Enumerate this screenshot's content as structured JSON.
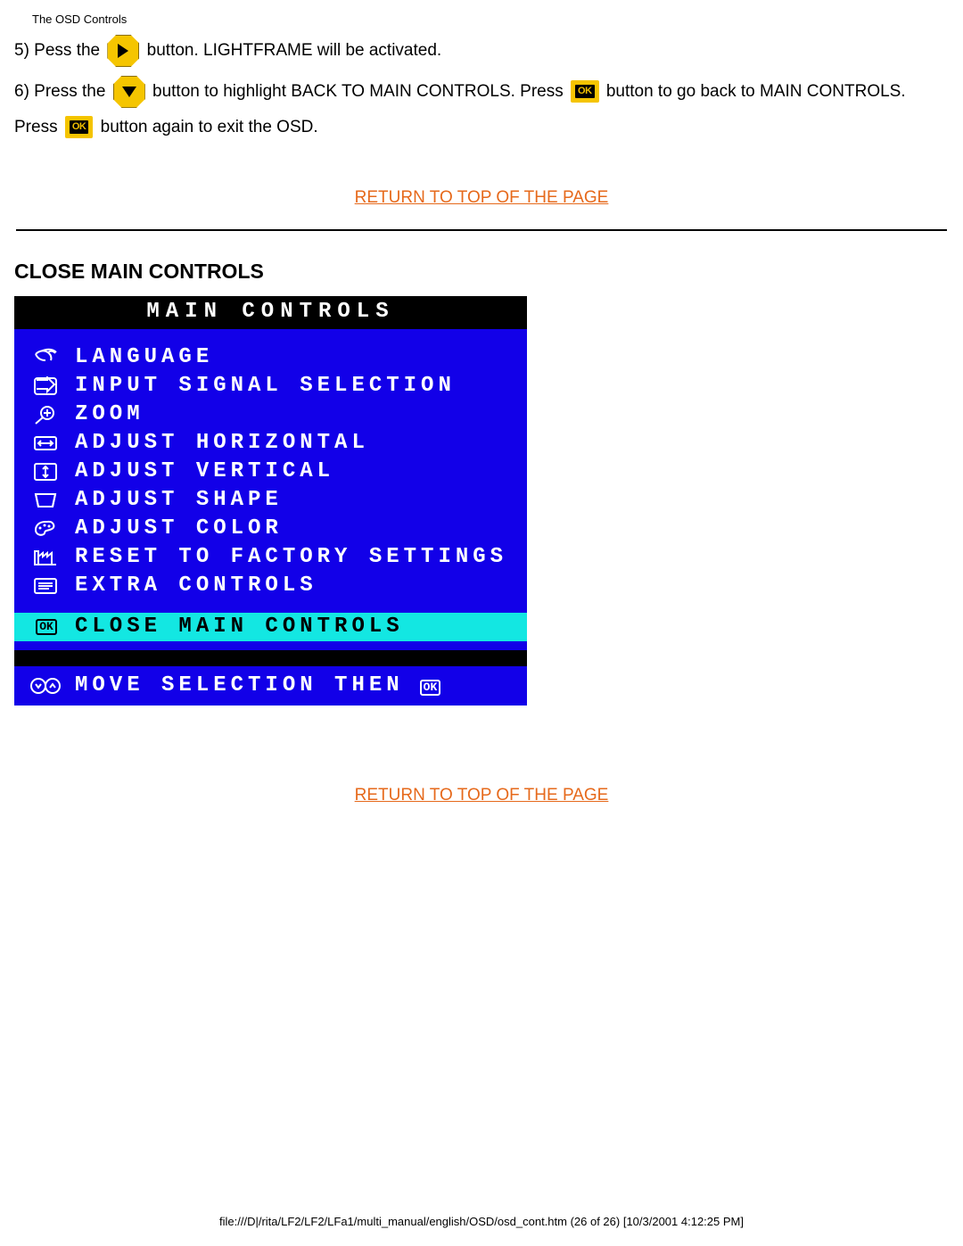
{
  "header": "The OSD Controls",
  "step5": {
    "prefix": "5) Pess the",
    "suffix": "button. LIGHTFRAME will be activated."
  },
  "step6": {
    "p1": "6) Press the",
    "p2": "button to highlight BACK TO MAIN CONTROLS. Press",
    "p3": "button to go back to MAIN CONTROLS. Press",
    "p4": "button again to exit the OSD."
  },
  "return_link": "RETURN TO TOP OF THE PAGE",
  "section_heading": "CLOSE MAIN CONTROLS",
  "osd": {
    "title": "MAIN CONTROLS",
    "items": [
      {
        "label": "LANGUAGE"
      },
      {
        "label": "INPUT SIGNAL SELECTION"
      },
      {
        "label": "ZOOM"
      },
      {
        "label": "ADJUST HORIZONTAL"
      },
      {
        "label": "ADJUST VERTICAL"
      },
      {
        "label": "ADJUST SHAPE"
      },
      {
        "label": "ADJUST COLOR"
      },
      {
        "label": "RESET TO FACTORY SETTINGS"
      },
      {
        "label": "EXTRA CONTROLS"
      }
    ],
    "selected": "CLOSE MAIN CONTROLS",
    "footer_text": "MOVE SELECTION THEN",
    "ok_label": "OK"
  },
  "footer_path": "file:///D|/rita/LF2/LF2/LFa1/multi_manual/english/OSD/osd_cont.htm (26 of 26) [10/3/2001 4:12:25 PM]"
}
